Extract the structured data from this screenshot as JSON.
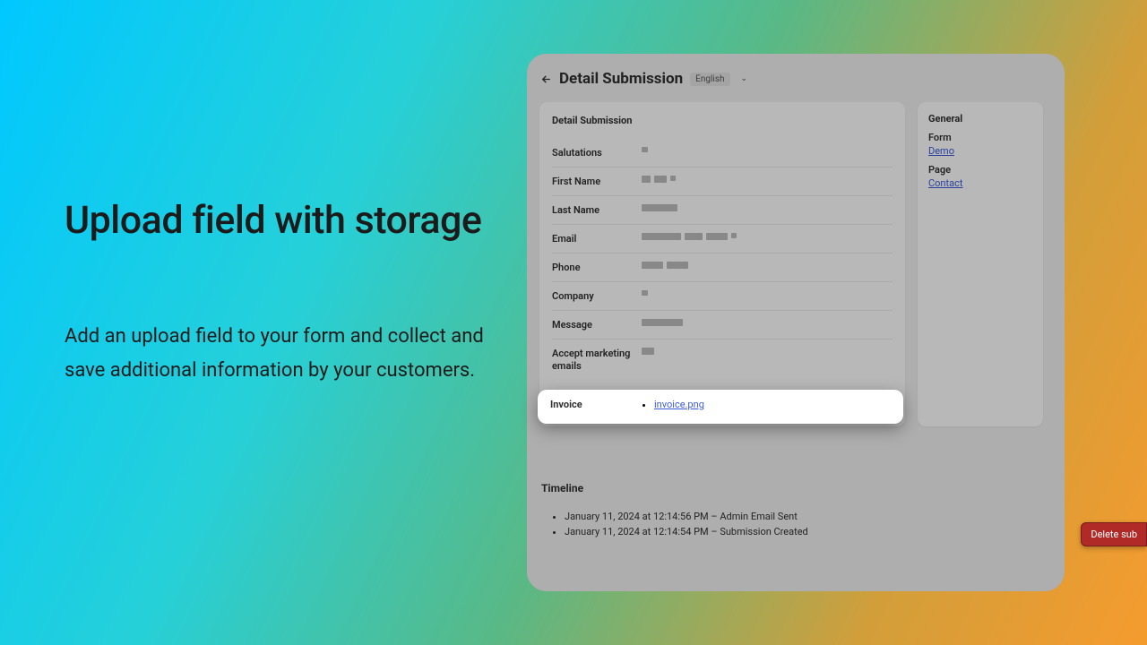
{
  "promo": {
    "title": "Upload field with storage",
    "body": "Add an upload field to your form and collect and save additional information by your customers."
  },
  "header": {
    "title": "Detail Submission",
    "language": "English"
  },
  "submission": {
    "card_title": "Detail Submission",
    "fields": {
      "salutations": "Salutations",
      "first_name": "First Name",
      "last_name": "Last Name",
      "email": "Email",
      "phone": "Phone",
      "company": "Company",
      "message": "Message",
      "accept_marketing": "Accept marketing emails",
      "invoice": "Invoice"
    },
    "invoice_file": "invoice.png"
  },
  "sidebar": {
    "title": "General",
    "form_label": "Form",
    "form_link": "Demo",
    "page_label": "Page",
    "page_link": "Contact"
  },
  "timeline": {
    "title": "Timeline",
    "items": [
      "January 11, 2024 at 12:14:56 PM – Admin Email Sent",
      "January 11, 2024 at 12:14:54 PM – Submission Created"
    ]
  },
  "actions": {
    "delete": "Delete sub"
  }
}
